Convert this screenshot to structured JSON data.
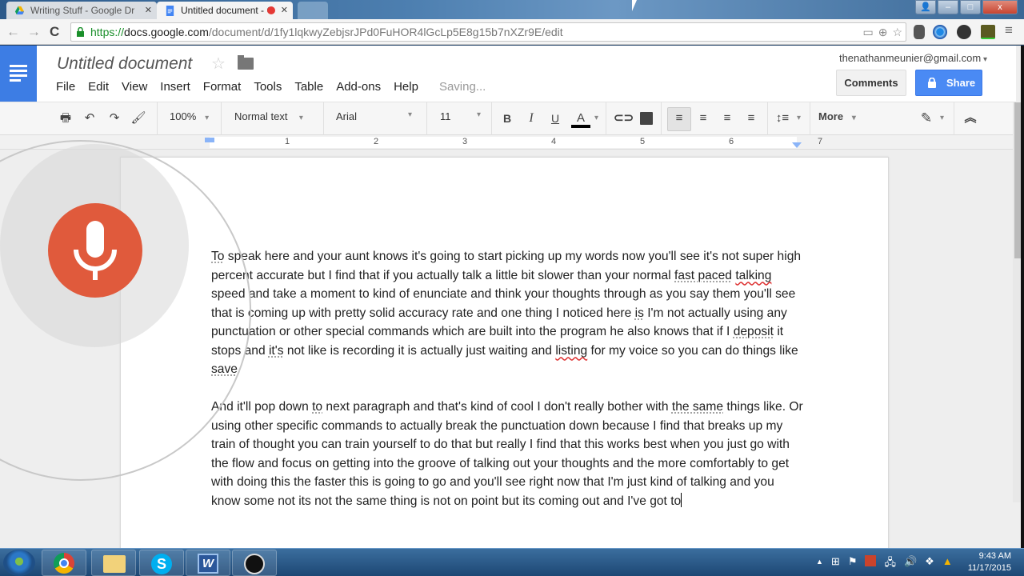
{
  "browser": {
    "tabs": [
      {
        "label": "Writing Stuff - Google Dr",
        "icon": "google-drive-icon",
        "active": false
      },
      {
        "label": "Untitled document - G",
        "icon": "google-docs-icon",
        "active": true,
        "recording": true
      }
    ],
    "url": {
      "scheme": "https://",
      "host": "docs.google.com",
      "path": "/document/d/1fy1lqkwyZebjsrJPd0FuHOR4lGcLp5E8g15b7nXZr9E/edit"
    },
    "window_buttons": {
      "minimize": "–",
      "maximize": "□",
      "close": "x"
    }
  },
  "docs": {
    "title": "Untitled document",
    "menu": [
      "File",
      "Edit",
      "View",
      "Insert",
      "Format",
      "Tools",
      "Table",
      "Add-ons",
      "Help"
    ],
    "save_status": "Saving...",
    "account_email": "thenathanmeunier@gmail.com",
    "comments_label": "Comments",
    "share_label": "Share",
    "toolbar": {
      "zoom": "100%",
      "style": "Normal text",
      "font": "Arial",
      "size": "11",
      "bold": "B",
      "italic": "I",
      "underline": "U",
      "text_color": "A",
      "more": "More"
    },
    "ruler_numbers": [
      "1",
      "2",
      "3",
      "4",
      "5",
      "6",
      "7"
    ],
    "paragraphs": [
      {
        "p1": "To",
        "p2": " speak here and your aunt knows it's going to start picking up my words now you'll see it's not super high percent accurate but I find that if you actually talk a little bit slower than your normal ",
        "p3": "fast paced",
        "p4": " ",
        "p5": "talking",
        "p6": " speed and take a moment to kind of enunciate and think your thoughts through as you say them you'll see that is coming up with pretty solid accuracy rate and one thing I noticed here ",
        "p7": "is",
        "p8": " I'm not actually using any punctuation or other special commands which are built into the program he also knows that if I ",
        "p9": "deposit",
        "p10": " it stops and ",
        "p11": "it's",
        "p12": " not like is recording it is actually just waiting and ",
        "p13": "listing",
        "p14": " for my voice so you can do things like ",
        "p15": "save"
      },
      {
        "p1": "And it'll pop down ",
        "p2": "to",
        "p3": " next paragraph and that's kind of cool I don't really bother with ",
        "p4": "the same",
        "p5": " things like. Or using other specific commands to actually break the punctuation down because I find that breaks up my train of thought you can train yourself to do that but really I find that this works best when you just go with the flow and focus on getting into the groove of talking out your thoughts and the more comfortably to get with doing this the faster this is going to go and you'll see right now that I'm just kind of talking and you know some not its not the same thing is not on point but its coming out and I've got to"
      }
    ]
  },
  "voice_typing": {
    "state": "listening",
    "icon": "microphone-icon",
    "color": "#e05a3c"
  },
  "taskbar": {
    "apps": [
      "windows-start",
      "chrome",
      "file-explorer",
      "skype",
      "word",
      "obs"
    ],
    "time": "9:43 AM",
    "date": "11/17/2015"
  },
  "colors": {
    "accent": "#4a8af4",
    "docs_blue": "#3d7de4",
    "mic_red": "#e05a3c"
  }
}
